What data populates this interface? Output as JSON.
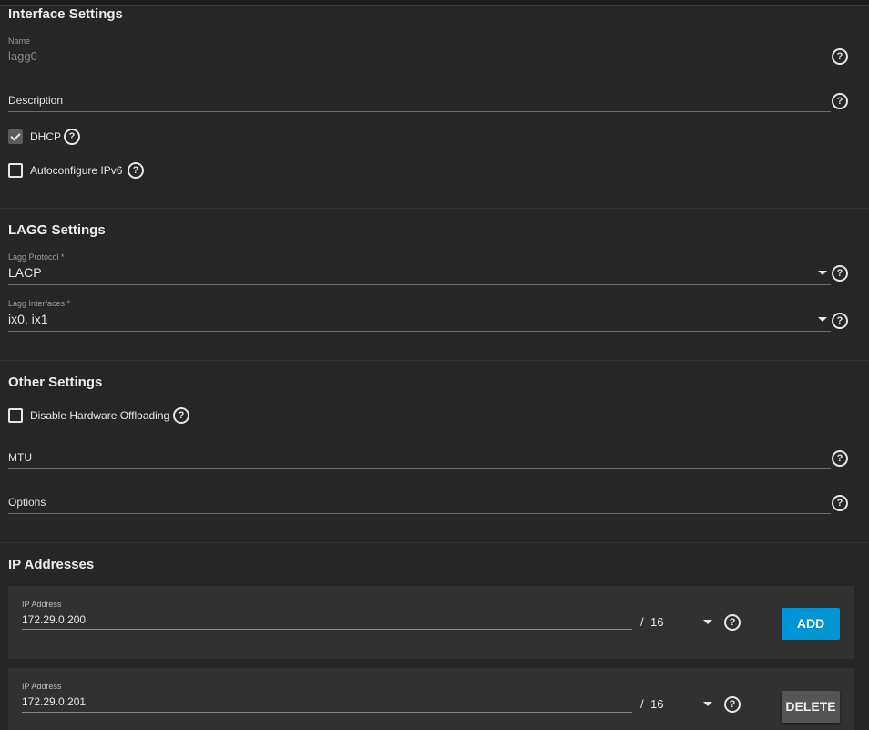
{
  "sections": {
    "interface": {
      "title": "Interface Settings",
      "name_label": "Name",
      "name_value": "lagg0",
      "description_placeholder": "Description",
      "dhcp_label": "DHCP",
      "dhcp_checked": true,
      "ipv6_label": "Autoconfigure IPv6",
      "ipv6_checked": false
    },
    "lagg": {
      "title": "LAGG Settings",
      "protocol_label": "Lagg Protocol *",
      "protocol_value": "LACP",
      "interfaces_label": "Lagg Interfaces *",
      "interfaces_value": "ix0, ix1"
    },
    "other": {
      "title": "Other Settings",
      "offload_label": "Disable Hardware Offloading",
      "offload_checked": false,
      "mtu_placeholder": "MTU",
      "options_placeholder": "Options"
    },
    "ip": {
      "title": "IP Addresses",
      "rows": [
        {
          "label": "IP Address",
          "value": "172.29.0.200",
          "slash": "/",
          "mask": "16",
          "button": "ADD"
        },
        {
          "label": "IP Address",
          "value": "172.29.0.201",
          "slash": "/",
          "mask": "16",
          "button": "DELETE"
        }
      ]
    }
  },
  "icons": {
    "help": "help-circle-icon",
    "caret": "dropdown-caret-icon",
    "check": "checkmark-icon"
  },
  "colors": {
    "background": "#262626",
    "card": "#313131",
    "accent": "#0095d5",
    "delete_button": "#555555"
  }
}
